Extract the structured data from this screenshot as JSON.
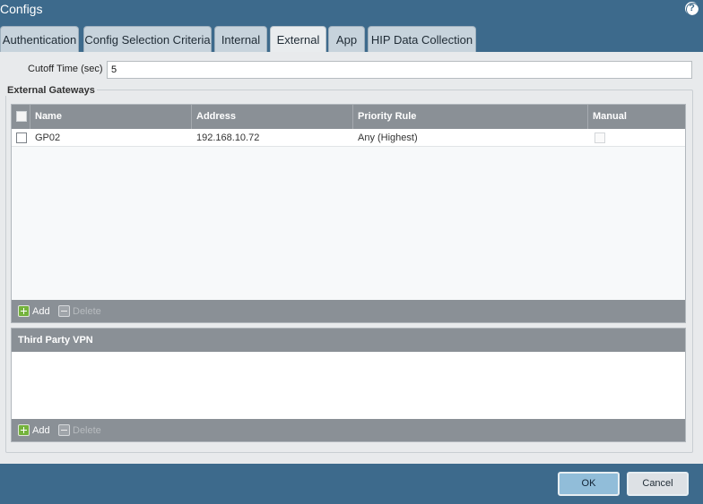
{
  "window": {
    "title": "Configs"
  },
  "tabs": [
    {
      "label": "Authentication"
    },
    {
      "label": "Config Selection Criteria"
    },
    {
      "label": "Internal"
    },
    {
      "label": "External"
    },
    {
      "label": "App"
    },
    {
      "label": "HIP Data Collection"
    }
  ],
  "cutoff": {
    "label": "Cutoff Time (sec)",
    "value": "5"
  },
  "external_gateways": {
    "legend": "External Gateways",
    "columns": [
      "Name",
      "Address",
      "Priority Rule",
      "Manual"
    ],
    "rows": [
      {
        "name": "GP02",
        "address": "192.168.10.72",
        "priority_rule": "Any (Highest)",
        "manual": false,
        "selected": false
      }
    ],
    "add_label": "Add",
    "delete_label": "Delete"
  },
  "third_party_vpn": {
    "header": "Third Party VPN",
    "add_label": "Add",
    "delete_label": "Delete"
  },
  "buttons": {
    "ok": "OK",
    "cancel": "Cancel"
  },
  "colors": {
    "titlebar": "#3d6a8c",
    "grid_header": "#8a9096",
    "add_green": "#74b33c"
  }
}
